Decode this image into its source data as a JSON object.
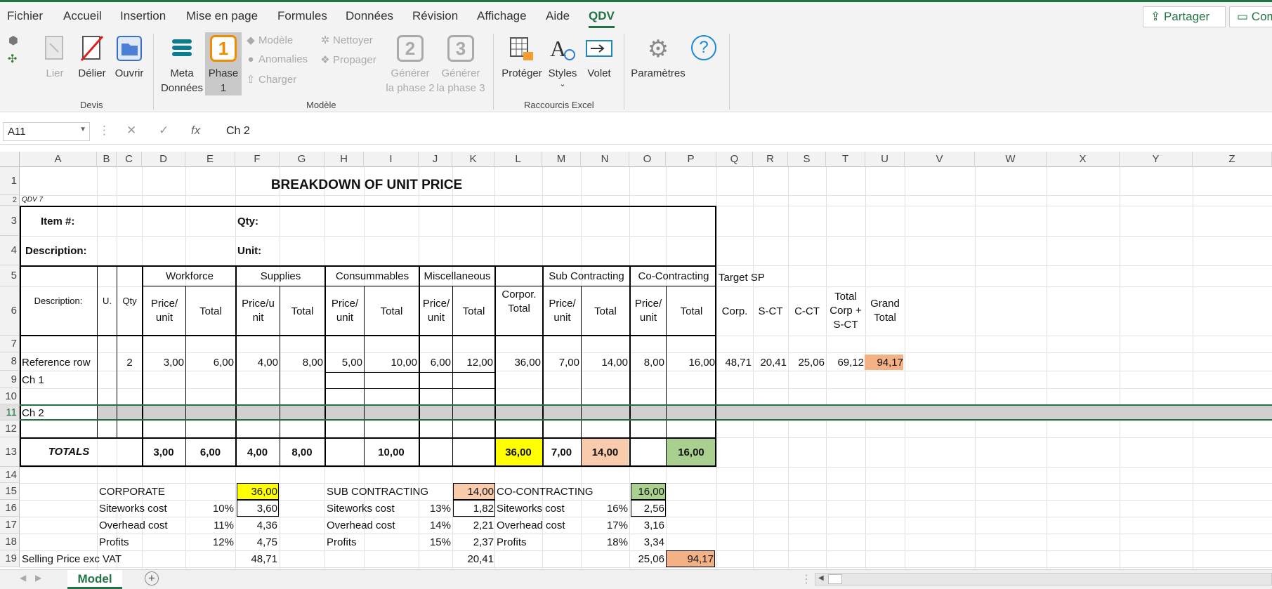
{
  "menu": {
    "tabs": [
      "Fichier",
      "Accueil",
      "Insertion",
      "Mise en page",
      "Formules",
      "Données",
      "Révision",
      "Affichage",
      "Aide",
      "QDV"
    ],
    "share": "Partager",
    "comments": "Com"
  },
  "ribbon": {
    "devis": {
      "lier": "Lier",
      "delier": "Délier",
      "ouvrir": "Ouvrir",
      "label": "Devis"
    },
    "modele": {
      "meta_line1": "Meta",
      "meta_line2": "Données",
      "phase_line1": "Phase",
      "phase_line2": "1",
      "phase_icon": "1",
      "modele_btn": "Modèle",
      "anomalies": "Anomalies",
      "charger": "Charger",
      "nettoyer": "Nettoyer",
      "propager": "Propager",
      "gen2_icon": "2",
      "gen2_line1": "Générer",
      "gen2_line2": "la phase 2",
      "gen3_icon": "3",
      "gen3_line1": "Générer",
      "gen3_line2": "la phase 3",
      "label": "Modèle"
    },
    "raccourcis": {
      "proteger": "Protéger",
      "styles": "Styles",
      "volet": "Volet",
      "label": "Raccourcis Excel"
    },
    "parametres": "Paramètres",
    "help": "?"
  },
  "formula_bar": {
    "name_box": "A11",
    "formula": "Ch 2",
    "fx": "fx"
  },
  "columns": [
    "A",
    "B",
    "C",
    "D",
    "E",
    "F",
    "G",
    "H",
    "I",
    "J",
    "K",
    "L",
    "M",
    "N",
    "O",
    "P",
    "Q",
    "R",
    "S",
    "T",
    "U",
    "V",
    "W",
    "X",
    "Y",
    "Z"
  ],
  "rows": [
    "1",
    "2",
    "3",
    "4",
    "5",
    "6",
    "7",
    "8",
    "9",
    "10",
    "11",
    "12",
    "13",
    "14",
    "15",
    "16",
    "17",
    "18",
    "19"
  ],
  "sheet": {
    "title": "BREAKDOWN OF UNIT PRICE",
    "qdv_tag": "QDV 7",
    "item_label": "Item #:",
    "qty_label": "Qty:",
    "desc_label": "Description:",
    "unit_label": "Unit:",
    "headers": {
      "description": "Description:",
      "u": "U.",
      "qty": "Qty",
      "workforce": "Workforce",
      "supplies": "Supplies",
      "consumables": "Consummables",
      "misc": "Miscellaneous",
      "corp_total": "Corpor. Total",
      "subcontracting": "Sub Contracting",
      "cocontracting": "Co-Contracting",
      "target_sp": "Target SP",
      "price_unit": "Price/ unit",
      "price_unit_split": "Price/u nit",
      "total": "Total",
      "corp": "Corp.",
      "sct": "S-CT",
      "cct": "C-CT",
      "total_corp_sct": "Total Corp + S-CT",
      "grand_total": "Grand Total"
    },
    "reference_row": {
      "label": "Reference row",
      "qty": "2",
      "values": [
        "3,00",
        "6,00",
        "4,00",
        "8,00",
        "5,00",
        "10,00",
        "6,00",
        "12,00",
        "36,00",
        "7,00",
        "14,00",
        "8,00",
        "16,00",
        "48,71",
        "20,41",
        "25,06",
        "69,12",
        "94,17"
      ]
    },
    "ch1": "Ch 1",
    "ch2": "Ch 2",
    "totals": {
      "label": "TOTALS",
      "values": [
        "3,00",
        "6,00",
        "4,00",
        "8,00",
        "10,00",
        "36,00",
        "7,00",
        "14,00",
        "16,00"
      ]
    },
    "summary": {
      "corporate": {
        "label": "CORPORATE",
        "value": "36,00",
        "rows": [
          [
            "Siteworks cost",
            "10%",
            "3,60"
          ],
          [
            "Overhead cost",
            "11%",
            "4,36"
          ],
          [
            "Profits",
            "12%",
            "4,75"
          ]
        ]
      },
      "sub": {
        "label": "SUB CONTRACTING",
        "value": "14,00",
        "rows": [
          [
            "Siteworks cost",
            "13%",
            "1,82"
          ],
          [
            "Overhead cost",
            "14%",
            "2,21"
          ],
          [
            "Profits",
            "15%",
            "2,37"
          ]
        ]
      },
      "co": {
        "label": "CO-CONTRACTING",
        "value": "16,00",
        "rows": [
          [
            "Siteworks cost",
            "16%",
            "2,56"
          ],
          [
            "Overhead cost",
            "17%",
            "3,16"
          ],
          [
            "Profits",
            "18%",
            "3,34"
          ]
        ]
      },
      "selling_label": "Selling Price  exc VAT",
      "selling_values": [
        "48,71",
        "20,41",
        "25,06",
        "94,17"
      ]
    }
  },
  "sheet_tab": "Model",
  "colors": {
    "accent": "#217346",
    "yellow": "#ffff00",
    "peach": "#f8cbad",
    "green": "#a9d08e",
    "orange": "#f4b183"
  }
}
